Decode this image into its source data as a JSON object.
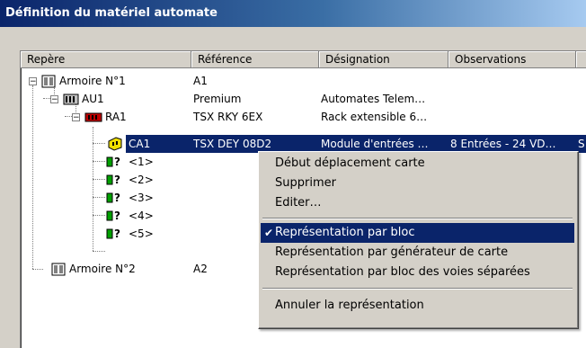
{
  "window": {
    "title": "Définition du matériel automate"
  },
  "columns": [
    "Repère",
    "Référence",
    "Désignation",
    "Observations"
  ],
  "rows": [
    {
      "label": "Armoire N°1",
      "reference": "A1",
      "designation": "",
      "observations": "",
      "icon": "cabinet-icon"
    },
    {
      "label": "AU1",
      "reference": "Premium",
      "designation": "Automates Telem…",
      "observations": "",
      "icon": "plc-icon"
    },
    {
      "label": "RA1",
      "reference": "TSX RKY 6EX",
      "designation": "Rack extensible 6…",
      "observations": "",
      "icon": "rack-icon"
    },
    {
      "label": "CA1",
      "reference": "TSX DEY 08D2",
      "designation": "Module d'entrées …",
      "observations": "8 Entrées - 24 VD…",
      "icon": "card-icon"
    },
    {
      "label": "<1>",
      "icon": "unknown-slot-icon"
    },
    {
      "label": "<2>",
      "icon": "unknown-slot-icon"
    },
    {
      "label": "<3>",
      "icon": "unknown-slot-icon"
    },
    {
      "label": "<4>",
      "icon": "unknown-slot-icon"
    },
    {
      "label": "<5>",
      "icon": "unknown-slot-icon"
    },
    {
      "label": "Armoire N°2",
      "reference": "A2",
      "designation": "",
      "observations": "",
      "icon": "cabinet-icon"
    }
  ],
  "selected_overflow": "S",
  "unknown_mark": "?",
  "context_menu": {
    "items": [
      "Début déplacement carte",
      "Supprimer",
      "Editer…",
      "Représentation par bloc",
      "Représentation par générateur de carte",
      "Représentation par bloc des voies séparées",
      "Annuler la représentation"
    ],
    "checked_item": "Représentation par bloc",
    "check_mark": "✔"
  },
  "colors": {
    "selection": "#0a246a",
    "titlebar": "#0a246a",
    "face": "#d4d0c8"
  }
}
